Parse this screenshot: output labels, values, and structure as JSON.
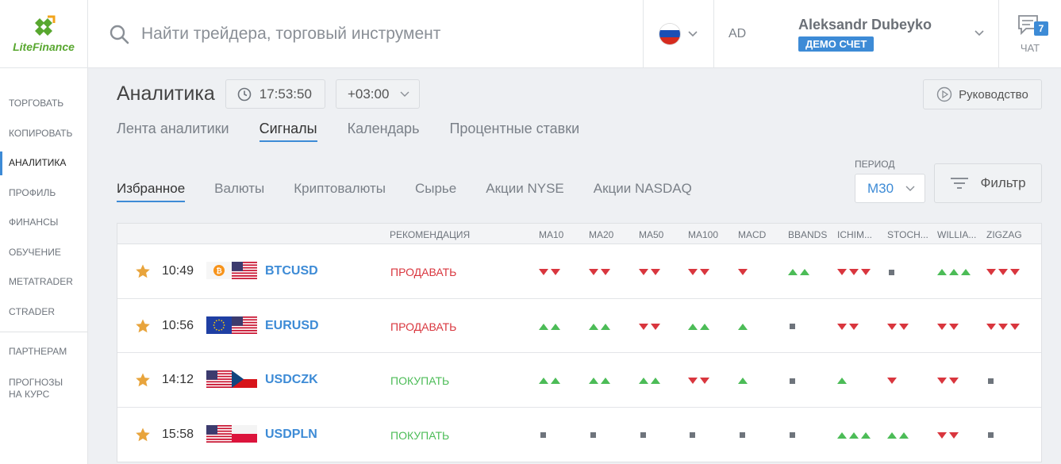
{
  "brand": {
    "name": "LiteFinance",
    "accent": "#58a72f"
  },
  "search": {
    "placeholder": "Найти трейдера, торговый инструмент",
    "icon": "search-icon"
  },
  "language": {
    "flag": "ru-flag-icon",
    "colors": [
      "#ffffff",
      "#1b4fb5",
      "#d52b1e"
    ]
  },
  "account": {
    "initials": "AD",
    "name": "Aleksandr Dubeyko",
    "badge": "ДЕМО СЧЕТ",
    "badge_color": "#3d8bd6"
  },
  "chat": {
    "label": "ЧАТ",
    "count": "7"
  },
  "sidebar": {
    "items": [
      {
        "label": "ТОРГОВАТЬ",
        "active": false
      },
      {
        "label": "КОПИРОВАТЬ",
        "active": false
      },
      {
        "label": "АНАЛИТИКА",
        "active": true
      },
      {
        "label": "ПРОФИЛЬ",
        "active": false
      },
      {
        "label": "ФИНАНСЫ",
        "active": false
      },
      {
        "label": "ОБУЧЕНИЕ",
        "active": false
      },
      {
        "label": "METATRADER",
        "active": false
      },
      {
        "label": "CTRADER",
        "active": false
      }
    ],
    "secondary": [
      {
        "label": "ПАРТНЕРАМ"
      },
      {
        "label_line1": "ПРОГНОЗЫ",
        "label_line2": "НА КУРС"
      }
    ]
  },
  "page": {
    "title": "Аналитика",
    "clock": "17:53:50",
    "timezone": "+03:00",
    "guide_label": "Руководство"
  },
  "tabs": [
    {
      "label": "Лента аналитики",
      "active": false
    },
    {
      "label": "Сигналы",
      "active": true
    },
    {
      "label": "Календарь",
      "active": false
    },
    {
      "label": "Процентные ставки",
      "active": false
    }
  ],
  "subtabs": [
    {
      "label": "Избранное",
      "active": true
    },
    {
      "label": "Валюты",
      "active": false
    },
    {
      "label": "Криптовалюты",
      "active": false
    },
    {
      "label": "Сырье",
      "active": false
    },
    {
      "label": "Акции NYSE",
      "active": false
    },
    {
      "label": "Акции NASDAQ",
      "active": false
    }
  ],
  "period": {
    "label": "ПЕРИОД",
    "value": "M30"
  },
  "filter": {
    "label": "Фильтр"
  },
  "table": {
    "headers": {
      "recommendation": "РЕКОМЕНДАЦИЯ",
      "indicators": [
        "MA10",
        "MA20",
        "MA50",
        "MA100",
        "MACD",
        "BBANDS",
        "ICHIM...",
        "STOCH...",
        "WILLIA...",
        "ZIGZAG"
      ]
    },
    "rows": [
      {
        "time": "10:49",
        "symbol": "BTCUSD",
        "rec": "ПРОДАВАТЬ",
        "rec_type": "sell",
        "flags": [
          "btc",
          "us"
        ],
        "signals": [
          "down:2",
          "down:2",
          "down:2",
          "down:2",
          "down:1",
          "up:2",
          "down:3",
          "neutral:1",
          "up:3",
          "down:3"
        ]
      },
      {
        "time": "10:56",
        "symbol": "EURUSD",
        "rec": "ПРОДАВАТЬ",
        "rec_type": "sell",
        "flags": [
          "eu",
          "us"
        ],
        "signals": [
          "up:2",
          "up:2",
          "down:2",
          "up:2",
          "up:1",
          "neutral:1",
          "down:2",
          "down:2",
          "down:2",
          "down:3"
        ]
      },
      {
        "time": "14:12",
        "symbol": "USDCZK",
        "rec": "ПОКУПАТЬ",
        "rec_type": "buy",
        "flags": [
          "us",
          "cz"
        ],
        "signals": [
          "up:2",
          "up:2",
          "up:2",
          "down:2",
          "up:1",
          "neutral:1",
          "up:1",
          "down:1",
          "down:2",
          "neutral:1"
        ]
      },
      {
        "time": "15:58",
        "symbol": "USDPLN",
        "rec": "ПОКУПАТЬ",
        "rec_type": "buy",
        "flags": [
          "us",
          "pl"
        ],
        "signals": [
          "neutral:1",
          "neutral:1",
          "neutral:1",
          "neutral:1",
          "neutral:1",
          "neutral:1",
          "up:3",
          "up:2",
          "down:2",
          "neutral:1"
        ]
      }
    ],
    "colors": {
      "sell": "#d9363e",
      "buy": "#4cbc57",
      "neutral": "#6e747c",
      "favorite_star": "#e8a43c"
    }
  }
}
